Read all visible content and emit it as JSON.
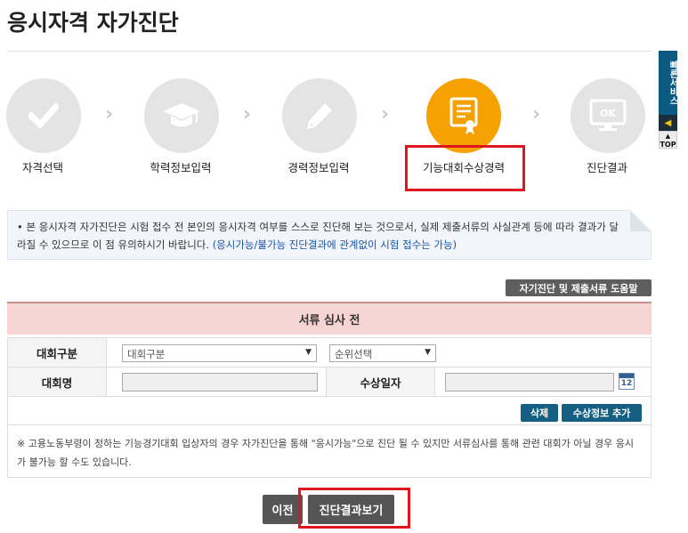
{
  "page": {
    "title": "응시자격 자가진단"
  },
  "steps": [
    {
      "label": "자격선택",
      "icon": "check-icon",
      "active": false
    },
    {
      "label": "학력정보입력",
      "icon": "graduation-cap-icon",
      "active": false
    },
    {
      "label": "경력정보입력",
      "icon": "pencil-icon",
      "active": false
    },
    {
      "label": "기능대회수상경력",
      "icon": "certificate-icon",
      "active": true
    },
    {
      "label": "진단결과",
      "icon": "monitor-ok-icon",
      "active": false
    }
  ],
  "step_icon_text": {
    "ok": "OK"
  },
  "quick_menu": {
    "label": "빠른서비스",
    "top": "TOP"
  },
  "notice": {
    "text": "본 응시자격 자가진단은 시험 접수 전 본인의 응시자격 여부를 스스로 진단해 보는 것으로서, 실제 제출서류의 사실관계 등에 따라 결과가 달라질 수 있으므로 이 점 유의하시기 바랍니다.",
    "highlight": "(응시가능/불가능 진단결과에 관계없이 시험 접수는 가능)"
  },
  "help_button": "자기진단 및 제출서류 도움말",
  "status": "서류 심사 전",
  "form": {
    "contest_type_label": "대회구분",
    "contest_type_select": "대회구분",
    "rank_select": "순위선택",
    "contest_name_label": "대회명",
    "award_date_label": "수상일자",
    "calendar_number": "12"
  },
  "actions": {
    "delete": "삭제",
    "add": "수상정보 추가"
  },
  "note": "※ 고용노동부령이 정하는 기능경기대회 입상자의 경우 자가진단을 통해 \"응시가능\"으로 진단 될 수 있지만 서류심사를 통해 관련 대회가 아닐 경우 응시가 불가능 할 수도 있습니다.",
  "bottom": {
    "prev": "이전",
    "result": "진단결과보기"
  },
  "colors": {
    "active_step": "#f5a100",
    "highlight": "#e0151d",
    "blue_button": "#155f83",
    "status_bg": "#f6d4d4"
  }
}
